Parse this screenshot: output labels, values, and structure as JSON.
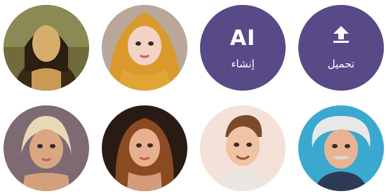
{
  "avatars": [
    {
      "name": "mona-lisa",
      "selected": false
    },
    {
      "name": "hijab-girl",
      "selected": true
    },
    {
      "name": "ponytail-girl",
      "selected": false
    },
    {
      "name": "wavy-hair-girl",
      "selected": false
    },
    {
      "name": "young-man",
      "selected": false
    },
    {
      "name": "einstein",
      "selected": false
    }
  ],
  "create_button": {
    "mark": "AI",
    "label": "إنشاء"
  },
  "upload_button": {
    "icon": "upload-icon",
    "label": "تحميل"
  },
  "colors": {
    "action_bg": "#574a86",
    "selected_ring": "#56d89a",
    "background": "#ffffff"
  }
}
